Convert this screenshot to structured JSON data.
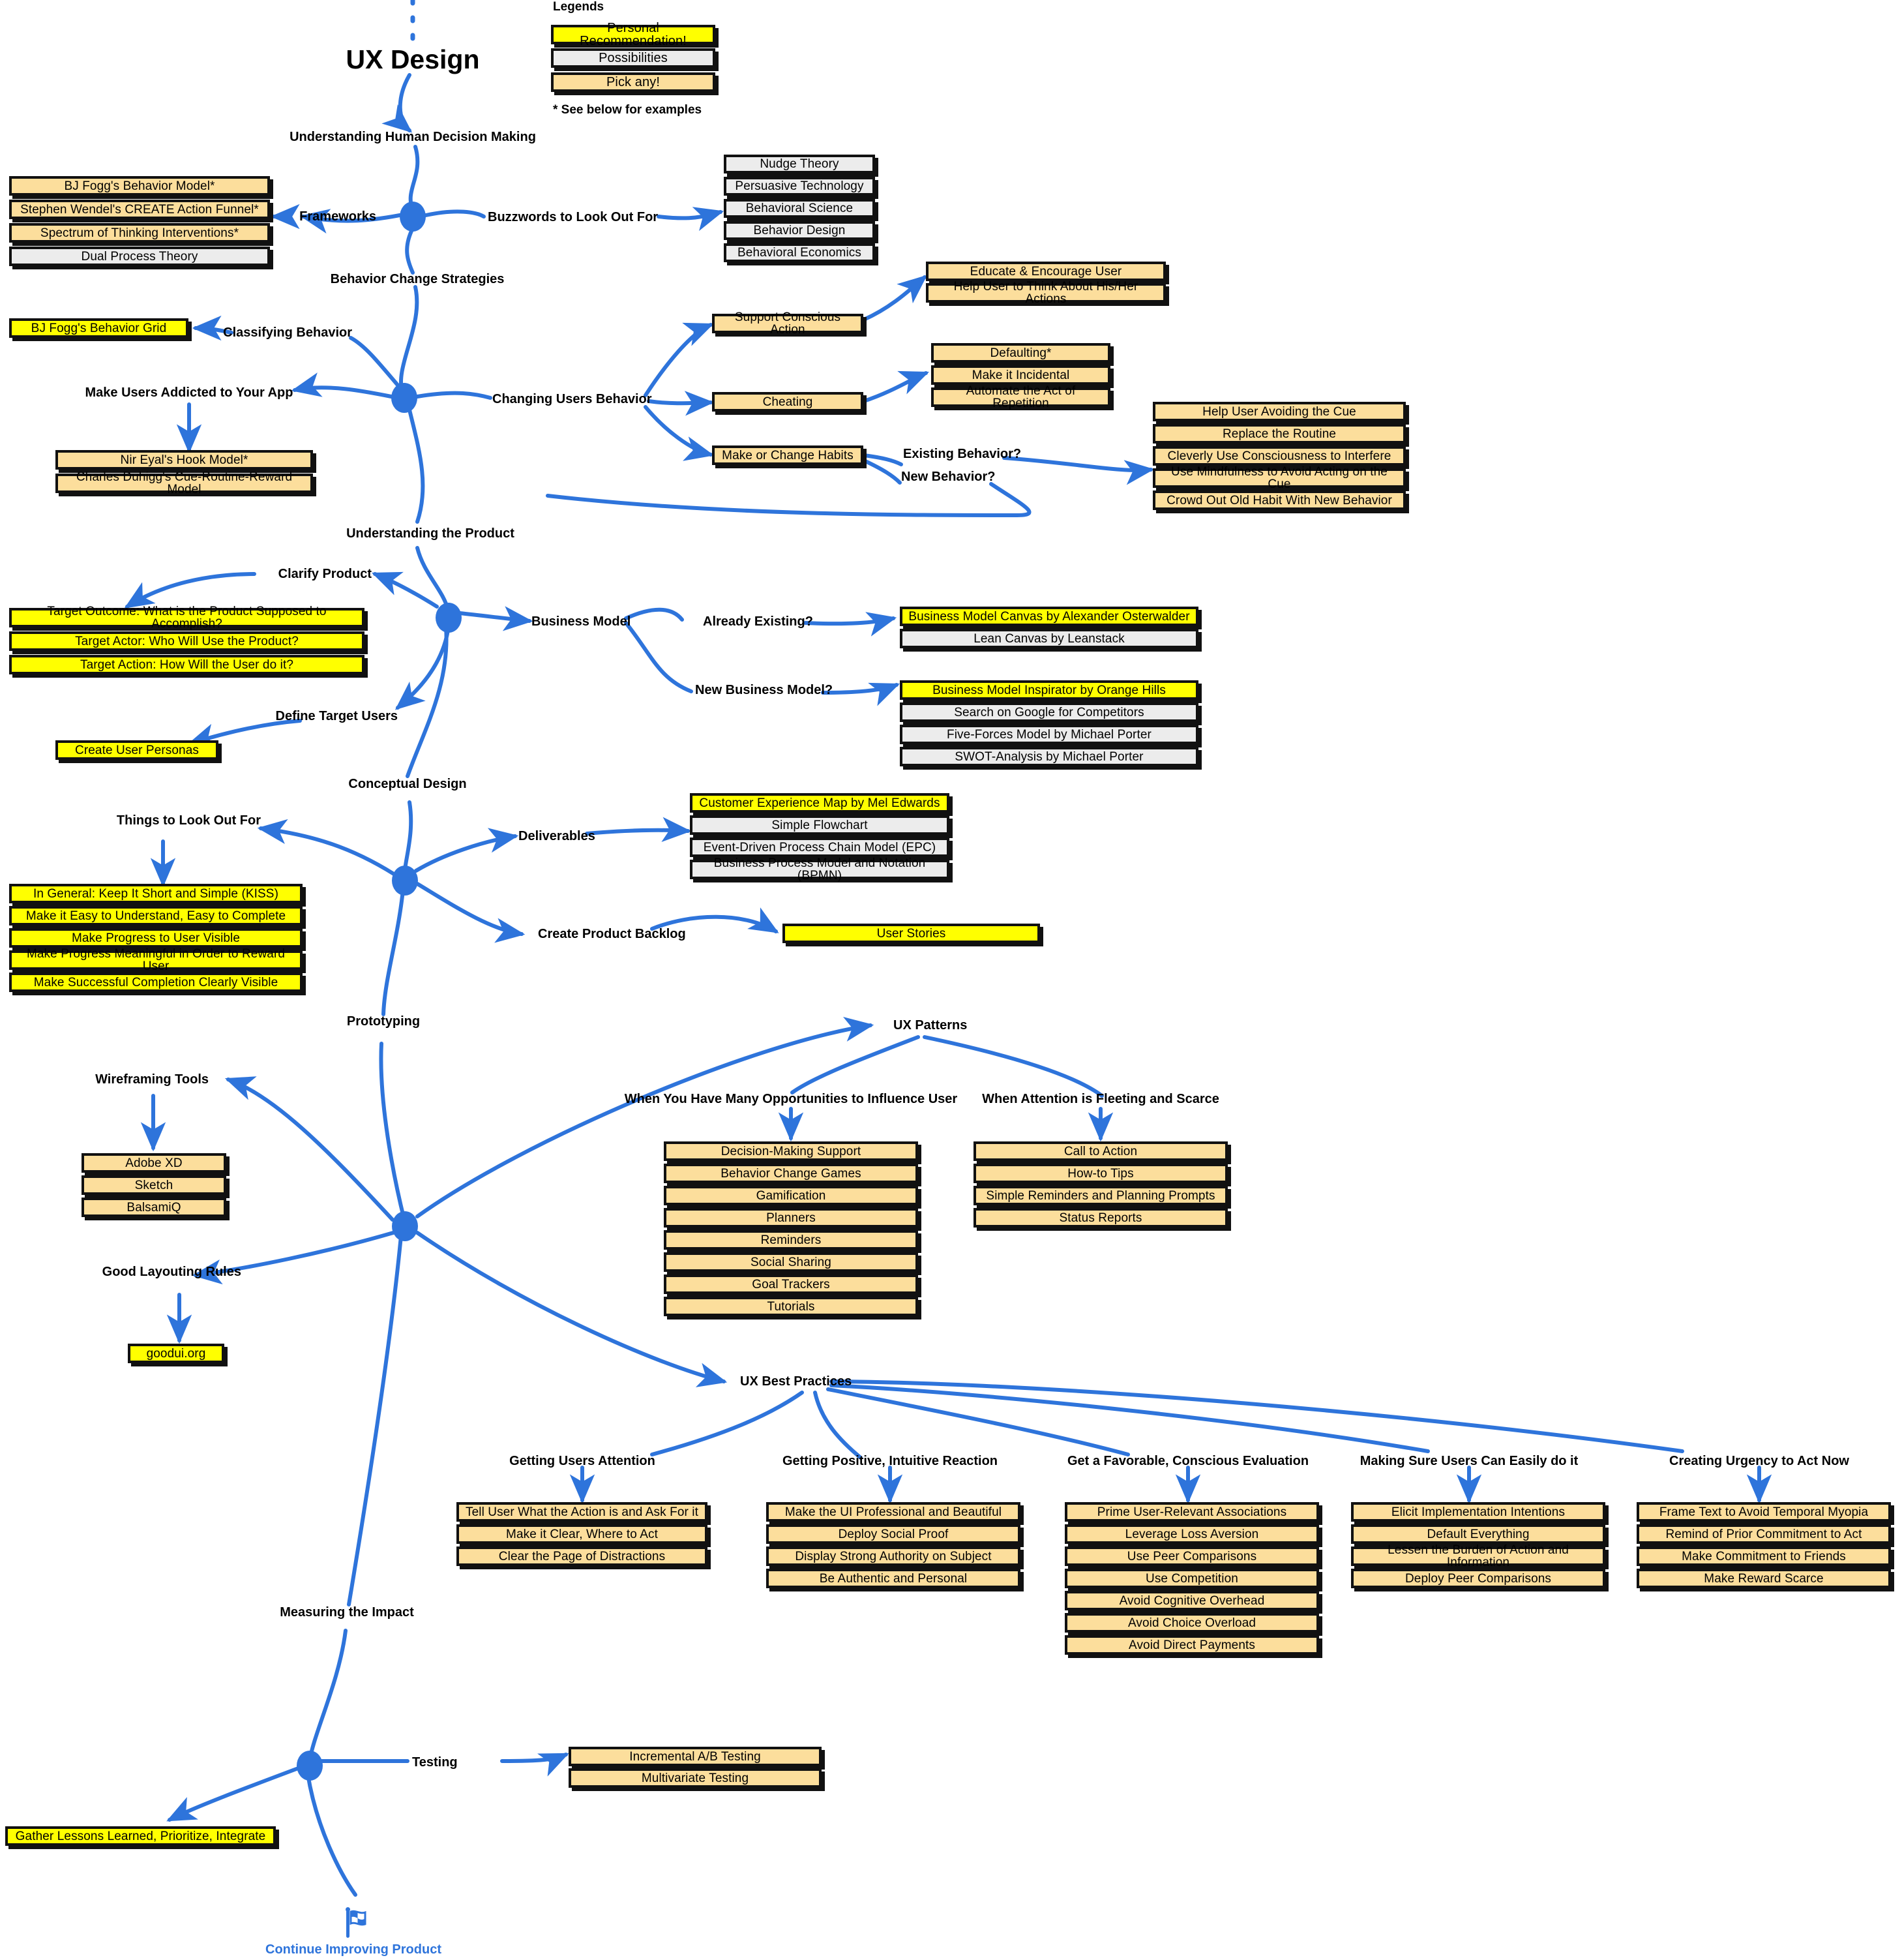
{
  "title": "UX Design",
  "colors": {
    "recommendation": "#FFFF00",
    "possibility": "#ECECEC",
    "pick_any": "#FCDE9C",
    "connector": "#2E74DB",
    "outline": "#111111"
  },
  "legend": {
    "heading": "Legends",
    "items": [
      {
        "label": "Personal Recommendation!",
        "style": "rec"
      },
      {
        "label": "Possibilities",
        "style": "pos"
      },
      {
        "label": "Pick any!",
        "style": "pick"
      }
    ],
    "footnote": "* See below for examples"
  },
  "branches": {
    "understanding_human_decision_making": "Understanding Human Decision Making",
    "behavior_change_strategies": "Behavior Change Strategies",
    "understanding_the_product": "Understanding the Product",
    "conceptual_design": "Conceptual Design",
    "prototyping": "Prototyping",
    "measuring_the_impact": "Measuring the Impact"
  },
  "labels": {
    "frameworks": "Frameworks",
    "buzzwords": "Buzzwords to Look Out For",
    "classifying_behavior": "Classifying Behavior",
    "make_users_addicted": "Make Users Addicted to Your App",
    "changing_users_behavior": "Changing Users Behavior",
    "existing_behavior": "Existing Behavior?",
    "new_behavior": "New Behavior?",
    "clarify_product": "Clarify Product",
    "business_model": "Business Model",
    "already_existing": "Already Existing?",
    "new_business_model": "New Business Model?",
    "define_target_users": "Define Target Users",
    "things_to_look_out_for": "Things to Look Out For",
    "deliverables": "Deliverables",
    "create_product_backlog": "Create Product Backlog",
    "wireframing_tools": "Wireframing Tools",
    "good_layouting_rules": "Good Layouting Rules",
    "ux_patterns": "UX Patterns",
    "many_opportunities": "When You Have Many Opportunities to Influence User",
    "attention_fleeting": "When Attention is Fleeting and Scarce",
    "ux_best_practices": "UX Best Practices",
    "getting_users_attention": "Getting Users Attention",
    "getting_positive_reaction": "Getting Positive, Intuitive Reaction",
    "favorable_evaluation": "Get a Favorable, Conscious Evaluation",
    "making_sure_easy": "Making Sure Users Can Easily do it",
    "creating_urgency": "Creating Urgency to Act Now",
    "testing": "Testing",
    "continue_improving": "Continue Improving Product"
  },
  "groups": {
    "frameworks": [
      {
        "label": "BJ Fogg's Behavior Model*",
        "style": "pick"
      },
      {
        "label": "Stephen Wendel's CREATE Action Funnel*",
        "style": "pick"
      },
      {
        "label": "Spectrum of Thinking Interventions*",
        "style": "pick"
      },
      {
        "label": "Dual Process Theory",
        "style": "pos"
      }
    ],
    "buzzwords": [
      {
        "label": "Nudge Theory",
        "style": "pos"
      },
      {
        "label": "Persuasive Technology",
        "style": "pos"
      },
      {
        "label": "Behavioral Science",
        "style": "pos"
      },
      {
        "label": "Behavior Design",
        "style": "pos"
      },
      {
        "label": "Behavioral Economics",
        "style": "pos"
      }
    ],
    "classifying_behavior": [
      {
        "label": "BJ Fogg's Behavior Grid",
        "style": "rec"
      }
    ],
    "addiction_models": [
      {
        "label": "Nir Eyal's Hook Model*",
        "style": "pick"
      },
      {
        "label": "Charles Duhigg's Cue-Routine-Reward Model",
        "style": "pick"
      }
    ],
    "changing_behavior_modes": [
      {
        "label": "Support Conscious Action",
        "style": "pick"
      },
      {
        "label": "Cheating",
        "style": "pick"
      },
      {
        "label": "Make or Change Habits",
        "style": "pick"
      }
    ],
    "support_conscious_action": [
      {
        "label": "Educate & Encourage User",
        "style": "pick"
      },
      {
        "label": "Help User to Think About His/Her Actions",
        "style": "pick"
      }
    ],
    "cheating": [
      {
        "label": "Defaulting*",
        "style": "pick"
      },
      {
        "label": "Make it Incidental",
        "style": "pick"
      },
      {
        "label": "Automate the Act of Repetition",
        "style": "pick"
      }
    ],
    "habits": [
      {
        "label": "Help User Avoiding the Cue",
        "style": "pick"
      },
      {
        "label": "Replace the Routine",
        "style": "pick"
      },
      {
        "label": "Cleverly Use Consciousness to Interfere",
        "style": "pick"
      },
      {
        "label": "Use Mindfulness to Avoid Acting on the Cue",
        "style": "pick"
      },
      {
        "label": "Crowd Out Old Habit With New Behavior",
        "style": "pick"
      }
    ],
    "clarify_product": [
      {
        "label": "Target Outcome: What is the Product Supposed to Accomplish?",
        "style": "rec"
      },
      {
        "label": "Target Actor: Who Will Use the Product?",
        "style": "rec"
      },
      {
        "label": "Target Action: How Will the User do it?",
        "style": "rec"
      }
    ],
    "already_existing": [
      {
        "label": "Business Model Canvas by Alexander Osterwalder",
        "style": "rec"
      },
      {
        "label": "Lean Canvas by Leanstack",
        "style": "pos"
      }
    ],
    "new_business_model": [
      {
        "label": "Business Model Inspirator by Orange Hills",
        "style": "rec"
      },
      {
        "label": "Search on Google for Competitors",
        "style": "pos"
      },
      {
        "label": "Five-Forces Model by Michael Porter",
        "style": "pos"
      },
      {
        "label": "SWOT-Analysis by Michael Porter",
        "style": "pos"
      }
    ],
    "define_target_users": [
      {
        "label": "Create User Personas",
        "style": "rec"
      }
    ],
    "things_to_look_out_for": [
      {
        "label": "In General: Keep It Short and Simple (KISS)",
        "style": "rec"
      },
      {
        "label": "Make it Easy to Understand, Easy to Complete",
        "style": "rec"
      },
      {
        "label": "Make Progress to User Visible",
        "style": "rec"
      },
      {
        "label": "Make Progress Meaningful in Order to Reward User",
        "style": "rec"
      },
      {
        "label": "Make Successful Completion Clearly Visible",
        "style": "rec"
      }
    ],
    "deliverables": [
      {
        "label": "Customer Experience Map by Mel Edwards",
        "style": "rec"
      },
      {
        "label": "Simple Flowchart",
        "style": "pos"
      },
      {
        "label": "Event-Driven Process Chain Model (EPC)",
        "style": "pos"
      },
      {
        "label": "Business Process Model and Notation (BPMN)",
        "style": "pos"
      }
    ],
    "product_backlog": [
      {
        "label": "User Stories",
        "style": "rec"
      }
    ],
    "wireframing_tools": [
      {
        "label": "Adobe XD",
        "style": "pick"
      },
      {
        "label": "Sketch",
        "style": "pick"
      },
      {
        "label": "BalsamiQ",
        "style": "pick"
      }
    ],
    "good_layouting_rules": [
      {
        "label": "goodui.org",
        "style": "rec"
      }
    ],
    "many_opportunities": [
      {
        "label": "Decision-Making Support",
        "style": "pick"
      },
      {
        "label": "Behavior Change Games",
        "style": "pick"
      },
      {
        "label": "Gamification",
        "style": "pick"
      },
      {
        "label": "Planners",
        "style": "pick"
      },
      {
        "label": "Reminders",
        "style": "pick"
      },
      {
        "label": "Social Sharing",
        "style": "pick"
      },
      {
        "label": "Goal Trackers",
        "style": "pick"
      },
      {
        "label": "Tutorials",
        "style": "pick"
      }
    ],
    "attention_fleeting": [
      {
        "label": "Call to Action",
        "style": "pick"
      },
      {
        "label": "How-to Tips",
        "style": "pick"
      },
      {
        "label": "Simple Reminders and Planning Prompts",
        "style": "pick"
      },
      {
        "label": "Status Reports",
        "style": "pick"
      }
    ],
    "getting_users_attention": [
      {
        "label": "Tell User What the Action is and Ask For it",
        "style": "pick"
      },
      {
        "label": "Make it Clear, Where to Act",
        "style": "pick"
      },
      {
        "label": "Clear the Page of Distractions",
        "style": "pick"
      }
    ],
    "getting_positive_reaction": [
      {
        "label": "Make the UI Professional and Beautiful",
        "style": "pick"
      },
      {
        "label": "Deploy Social Proof",
        "style": "pick"
      },
      {
        "label": "Display Strong Authority on Subject",
        "style": "pick"
      },
      {
        "label": "Be Authentic and Personal",
        "style": "pick"
      }
    ],
    "favorable_evaluation": [
      {
        "label": "Prime User-Relevant Associations",
        "style": "pick"
      },
      {
        "label": "Leverage Loss Aversion",
        "style": "pick"
      },
      {
        "label": "Use Peer Comparisons",
        "style": "pick"
      },
      {
        "label": "Use Competition",
        "style": "pick"
      },
      {
        "label": "Avoid Cognitive Overhead",
        "style": "pick"
      },
      {
        "label": "Avoid Choice Overload",
        "style": "pick"
      },
      {
        "label": "Avoid Direct Payments",
        "style": "pick"
      }
    ],
    "making_sure_easy": [
      {
        "label": "Elicit Implementation Intentions",
        "style": "pick"
      },
      {
        "label": "Default Everything",
        "style": "pick"
      },
      {
        "label": "Lessen the Burden of Action and Information",
        "style": "pick"
      },
      {
        "label": "Deploy Peer Comparisons",
        "style": "pick"
      }
    ],
    "creating_urgency": [
      {
        "label": "Frame Text to Avoid Temporal Myopia",
        "style": "pick"
      },
      {
        "label": "Remind of Prior Commitment to Act",
        "style": "pick"
      },
      {
        "label": "Make Commitment to Friends",
        "style": "pick"
      },
      {
        "label": "Make Reward Scarce",
        "style": "pick"
      }
    ],
    "testing": [
      {
        "label": "Incremental A/B Testing",
        "style": "pick"
      },
      {
        "label": "Multivariate Testing",
        "style": "pick"
      }
    ],
    "lessons": [
      {
        "label": "Gather Lessons Learned, Prioritize, Integrate",
        "style": "rec"
      }
    ]
  }
}
